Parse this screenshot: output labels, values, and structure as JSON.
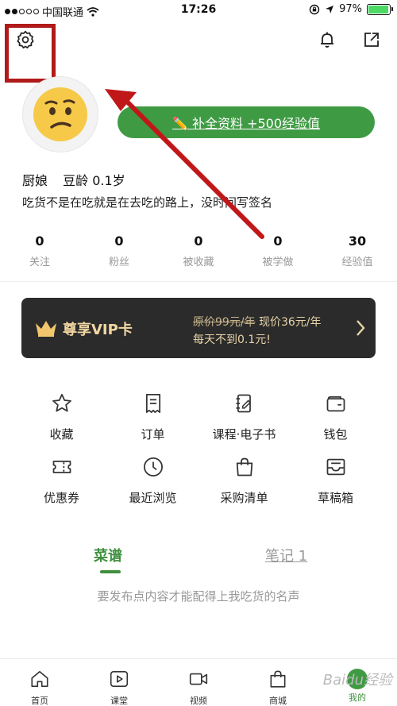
{
  "status_bar": {
    "carrier": "中国联通",
    "time": "17:26",
    "battery": "97%",
    "battery_level": 0.97
  },
  "profile": {
    "complete_button": "✏️ 补全资料 +500经验值",
    "name": "厨娘",
    "bean_age": "豆龄 0.1岁",
    "signature": "吃货不是在吃就是在去吃的路上，没时间写签名"
  },
  "stats": [
    {
      "num": "0",
      "label": "关注"
    },
    {
      "num": "0",
      "label": "粉丝"
    },
    {
      "num": "0",
      "label": "被收藏"
    },
    {
      "num": "0",
      "label": "被学做"
    },
    {
      "num": "30",
      "label": "经验值"
    }
  ],
  "vip": {
    "title": "尊享VIP卡",
    "old_price": "原价99元/年",
    "new_price": " 现价36元/年",
    "subtitle": "每天不到0.1元!"
  },
  "grid": [
    {
      "label": "收藏",
      "icon": "star-icon"
    },
    {
      "label": "订单",
      "icon": "receipt-icon"
    },
    {
      "label": "课程·电子书",
      "icon": "notebook-icon"
    },
    {
      "label": "钱包",
      "icon": "wallet-icon"
    },
    {
      "label": "优惠券",
      "icon": "coupon-icon"
    },
    {
      "label": "最近浏览",
      "icon": "clock-icon"
    },
    {
      "label": "采购清单",
      "icon": "shopping-bag-icon"
    },
    {
      "label": "草稿箱",
      "icon": "inbox-icon"
    }
  ],
  "tabs": {
    "recipes": "菜谱",
    "notes": "笔记 1"
  },
  "empty_hint": "要发布点内容才能配得上我吃货的名声",
  "bottom_nav": [
    {
      "label": "首页",
      "icon": "home-icon"
    },
    {
      "label": "课堂",
      "icon": "play-icon"
    },
    {
      "label": "视频",
      "icon": "video-icon"
    },
    {
      "label": "商城",
      "icon": "bag-icon"
    },
    {
      "label": "我的",
      "icon": "me-icon"
    }
  ],
  "watermark": "Baidu经验",
  "colors": {
    "accent_green": "#3f9b43",
    "highlight_red": "#b11a1a",
    "vip_bg": "#2b2b2b",
    "vip_gold": "#f2d7a3"
  }
}
